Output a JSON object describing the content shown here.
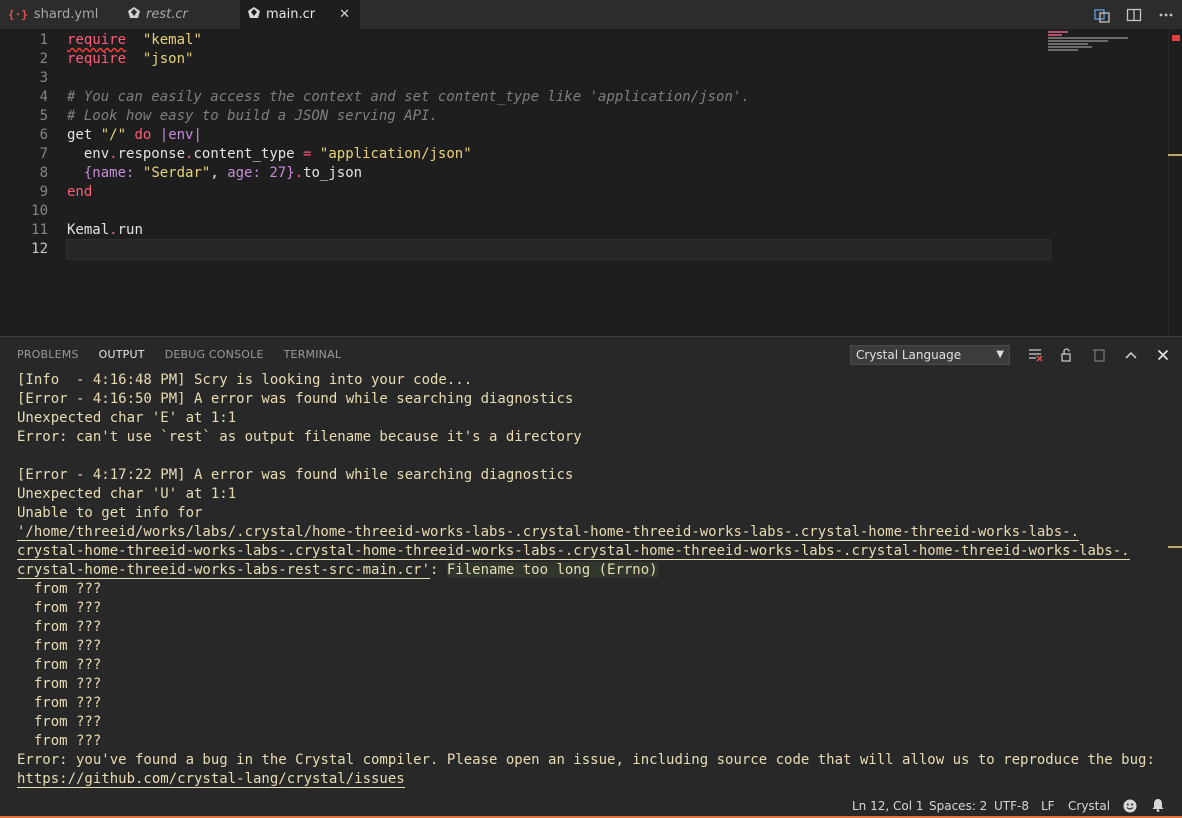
{
  "tabs": [
    {
      "label": "shard.yml",
      "icon": "yaml-braces-icon",
      "italic": false,
      "active": false
    },
    {
      "label": "rest.cr",
      "icon": "crystal-icon",
      "italic": true,
      "active": false
    },
    {
      "label": "main.cr",
      "icon": "crystal-icon",
      "italic": false,
      "active": true
    }
  ],
  "tab_close_glyph": "✕",
  "editor": {
    "line_numbers": [
      "1",
      "2",
      "3",
      "4",
      "5",
      "6",
      "7",
      "8",
      "9",
      "10",
      "11",
      "12"
    ],
    "current_line": "12",
    "lines": [
      [
        [
          "kw sq",
          "require"
        ],
        [
          "",
          "  "
        ],
        [
          "str",
          "\"kemal\""
        ]
      ],
      [
        [
          "kw",
          "require"
        ],
        [
          "",
          "  "
        ],
        [
          "str",
          "\"json\""
        ]
      ],
      [],
      [
        [
          "cmt",
          "# You can easily access the context and set content_type like 'application/json'."
        ]
      ],
      [
        [
          "cmt",
          "# Look how easy to build a JSON serving API."
        ]
      ],
      [
        [
          "",
          "get "
        ],
        [
          "str",
          "\"/\""
        ],
        [
          "",
          " "
        ],
        [
          "kw",
          "do"
        ],
        [
          "",
          " "
        ],
        [
          "sym",
          "|"
        ],
        [
          "sym",
          "env"
        ],
        [
          "sym",
          "|"
        ]
      ],
      [
        [
          "",
          "  env"
        ],
        [
          "kw",
          "."
        ],
        [
          "",
          "response"
        ],
        [
          "kw",
          "."
        ],
        [
          "",
          "content_type "
        ],
        [
          "kw",
          "="
        ],
        [
          "",
          " "
        ],
        [
          "str",
          "\"application/json\""
        ]
      ],
      [
        [
          "",
          "  "
        ],
        [
          "sym",
          "{"
        ],
        [
          "sym",
          "name:"
        ],
        [
          "",
          " "
        ],
        [
          "str",
          "\"Serdar\""
        ],
        [
          "",
          ", "
        ],
        [
          "sym",
          "age:"
        ],
        [
          "",
          " "
        ],
        [
          "num",
          "27"
        ],
        [
          "sym",
          "}"
        ],
        [
          "kw",
          "."
        ],
        [
          "",
          "to_json"
        ]
      ],
      [
        [
          "kw",
          "end"
        ]
      ],
      [],
      [
        [
          "",
          "Kemal"
        ],
        [
          "kw",
          "."
        ],
        [
          "",
          "run"
        ]
      ],
      []
    ]
  },
  "panel": {
    "tabs": [
      "PROBLEMS",
      "OUTPUT",
      "DEBUG CONSOLE",
      "TERMINAL"
    ],
    "active_tab": "OUTPUT",
    "channel_select": "Crystal Language",
    "output_lines": [
      "[Info  - 4:16:48 PM] Scry is looking into your code...",
      "[Error - 4:16:50 PM] A error was found while searching diagnostics",
      "Unexpected char 'E' at 1:1",
      "Error: can't use `rest` as output filename because it's a directory",
      "",
      "[Error - 4:17:22 PM] A error was found while searching diagnostics",
      "Unexpected char 'U' at 1:1",
      "Unable to get info for"
    ],
    "path_lines": [
      "'/home/threeid/works/labs/.crystal/home-threeid-works-labs-.crystal-home-threeid-works-labs-.crystal-home-threeid-works-labs-.",
      "crystal-home-threeid-works-labs-.crystal-home-threeid-works-labs-.crystal-home-threeid-works-labs-.crystal-home-threeid-works-labs-.",
      "crystal-home-threeid-works-labs-rest-src-main.cr'"
    ],
    "path_suffix_sep": ": ",
    "path_suffix_hl": "Filename too long (Errno)",
    "from_lines": [
      "  from ???",
      "  from ???",
      "  from ???",
      "  from ???",
      "  from ???",
      "  from ???",
      "  from ???",
      "  from ???",
      "  from ???"
    ],
    "bug_line": "Error: you've found a bug in the Crystal compiler. Please open an issue, including source code that will allow us to reproduce the bug:",
    "issue_url": "https://github.com/crystal-lang/crystal/issues"
  },
  "status": {
    "position": "Ln 12, Col 1",
    "spaces": "Spaces: 2",
    "encoding": "UTF-8",
    "eol": "LF",
    "language": "Crystal",
    "feedback_icon": "smiley-icon",
    "notifications_icon": "bell-icon"
  }
}
